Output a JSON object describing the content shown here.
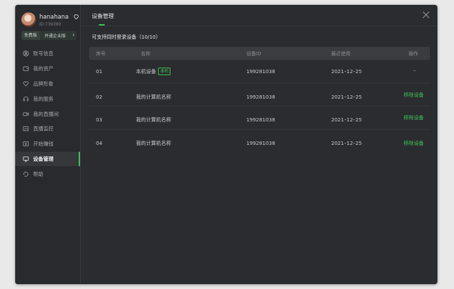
{
  "colors": {
    "accent": "#3fbf58",
    "window_bg": "#2b2c2f",
    "sidebar_bg": "#292a2d",
    "header_bg": "#3b3c40"
  },
  "user": {
    "name": "hanahana",
    "id_label": "ID:739390",
    "badge_icon": "gem-icon"
  },
  "plan": {
    "badge": "免费版",
    "upgrade_label": "开通企业版",
    "chevron": "›"
  },
  "sidebar": {
    "items": [
      {
        "label": "账号信息",
        "icon": "user-circle-icon",
        "active": false
      },
      {
        "label": "我的资产",
        "icon": "wallet-icon",
        "active": false
      },
      {
        "label": "品牌形象",
        "icon": "heart-icon",
        "active": false
      },
      {
        "label": "我的服务",
        "icon": "headset-icon",
        "active": false
      },
      {
        "label": "我的直播间",
        "icon": "camera-icon",
        "active": false
      },
      {
        "label": "直播监控",
        "icon": "monitor-chart-icon",
        "active": false
      },
      {
        "label": "开始赚钱",
        "icon": "money-icon",
        "active": false
      },
      {
        "label": "设备管理",
        "icon": "desktop-icon",
        "active": true
      },
      {
        "label": "帮助",
        "icon": "help-icon",
        "active": false
      }
    ]
  },
  "header": {
    "title": "设备管理",
    "close_icon": "close-icon"
  },
  "summary": "可支持同时登录设备（10/10）",
  "table": {
    "columns": [
      "序号",
      "名称",
      "设备ID",
      "最近使用",
      "操作"
    ],
    "rows": [
      {
        "index": "01",
        "name": "本机设备",
        "tag": "本机",
        "device_id": "199281038",
        "last_used": "2021–12–25",
        "action": "–",
        "action_is_link": false
      },
      {
        "index": "02",
        "name": "我的计算机名称",
        "tag": "",
        "device_id": "199281038",
        "last_used": "2021–12–25",
        "action": "移除设备",
        "action_is_link": true
      },
      {
        "index": "03",
        "name": "我的计算机名称",
        "tag": "",
        "device_id": "199281038",
        "last_used": "2021–12–25",
        "action": "移除设备",
        "action_is_link": true
      },
      {
        "index": "04",
        "name": "我的计算机名称",
        "tag": "",
        "device_id": "199281038",
        "last_used": "2021–12–25",
        "action": "移除设备",
        "action_is_link": true
      }
    ]
  }
}
